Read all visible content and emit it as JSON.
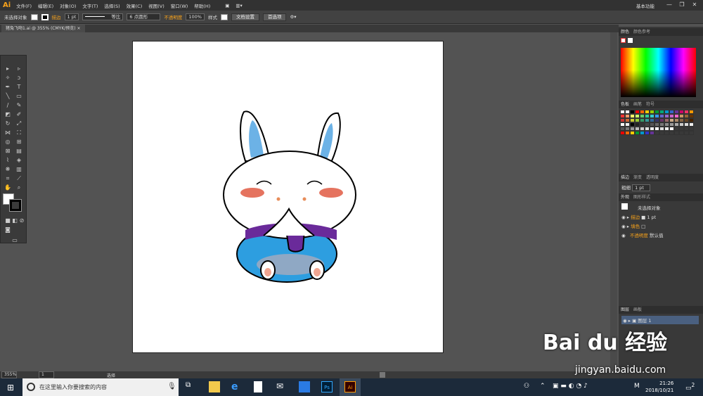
{
  "menubar": {
    "logo": "Ai",
    "items": [
      "文件(F)",
      "编辑(E)",
      "对象(O)",
      "文字(T)",
      "选择(S)",
      "效果(C)",
      "视图(V)",
      "窗口(W)",
      "帮助(H)"
    ],
    "workspace": "基本功能"
  },
  "control": {
    "no_selection": "未选择对象",
    "stroke_label": "描边",
    "stroke_weight": "1 pt",
    "stroke_style": "等比",
    "brush": "6 点圆形",
    "opacity_label": "不透明度",
    "opacity": "100%",
    "style_label": "样式",
    "doc_setup": "文档设置",
    "prefs": "首选项"
  },
  "document": {
    "tab": "猪兔飞吻1.ai @ 355% (CMYK/预览)"
  },
  "panels": {
    "color_tabs": [
      "颜色",
      "颜色参考"
    ],
    "swatch_tabs": [
      "色板",
      "画笔",
      "符号"
    ],
    "stroke_tabs": [
      "描边",
      "渐变",
      "透明度"
    ],
    "stroke_weight_label": "粗细",
    "stroke_weight": "1 pt",
    "appearance_tabs": [
      "外观",
      "图形样式"
    ],
    "appearance_title": "未选择对象",
    "appearance_stroke": "描边",
    "appearance_stroke_val": "1 pt",
    "appearance_fill": "填色",
    "appearance_opacity": "不透明度",
    "appearance_opacity_val": "默认值",
    "layer_tabs": [
      "图层",
      "画板"
    ],
    "layer_name": "图层 1"
  },
  "status": {
    "zoom": "355%",
    "page": "1",
    "mode": "选择"
  },
  "taskbar": {
    "search_placeholder": "在这里输入你要搜索的内容",
    "time": "21:26",
    "date": "2018/10/21",
    "ime": "M",
    "notif": "2"
  },
  "watermark": {
    "brand": "Bai du 经验",
    "url": "jingyan.baidu.com"
  }
}
